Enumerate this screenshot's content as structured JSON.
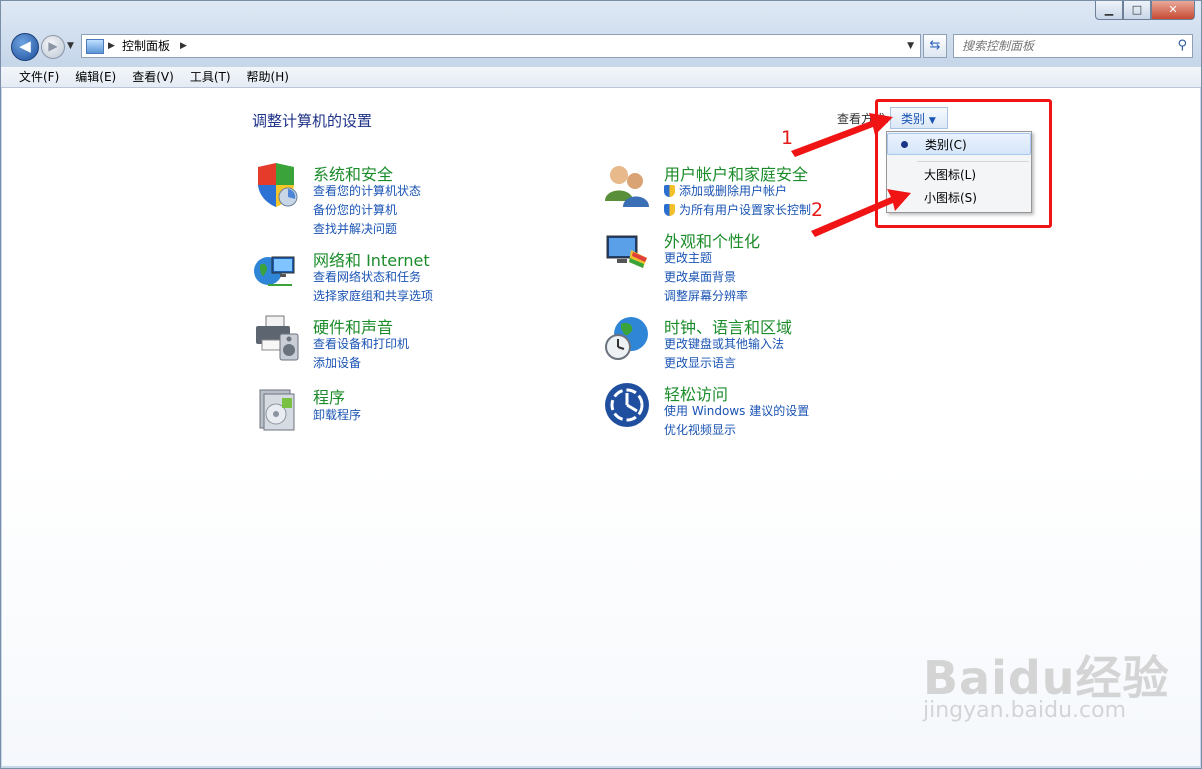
{
  "window": {
    "minimize": "▁",
    "maximize": "□",
    "close": "✕"
  },
  "nav": {
    "back_icon": "arrow-left",
    "forward_icon": "arrow-right"
  },
  "address": {
    "crumb": "控制面板"
  },
  "search": {
    "placeholder": "搜索控制面板"
  },
  "menubar": [
    "文件(F)",
    "编辑(E)",
    "查看(V)",
    "工具(T)",
    "帮助(H)"
  ],
  "page": {
    "title": "调整计算机的设置",
    "view_by_label": "查看方式:",
    "view_by_value": "类别"
  },
  "categories_left": [
    {
      "title": "系统和安全",
      "links": [
        "查看您的计算机状态",
        "备份您的计算机",
        "查找并解决问题"
      ]
    },
    {
      "title": "网络和 Internet",
      "links": [
        "查看网络状态和任务",
        "选择家庭组和共享选项"
      ]
    },
    {
      "title": "硬件和声音",
      "links": [
        "查看设备和打印机",
        "添加设备"
      ]
    },
    {
      "title": "程序",
      "links": [
        "卸载程序"
      ]
    }
  ],
  "categories_right": [
    {
      "title": "用户帐户和家庭安全",
      "links": [
        "添加或删除用户帐户",
        "为所有用户设置家长控制"
      ]
    },
    {
      "title": "外观和个性化",
      "links": [
        "更改主题",
        "更改桌面背景",
        "调整屏幕分辨率"
      ]
    },
    {
      "title": "时钟、语言和区域",
      "links": [
        "更改键盘或其他输入法",
        "更改显示语言"
      ]
    },
    {
      "title": "轻松访问",
      "links": [
        "使用 Windows 建议的设置",
        "优化视频显示"
      ]
    }
  ],
  "view_menu": {
    "items": [
      "类别(C)",
      "大图标(L)",
      "小图标(S)"
    ],
    "selected": "类别(C)"
  },
  "annotations": {
    "step1": "1",
    "step2": "2",
    "color": "#f01414"
  },
  "watermark": {
    "brand": "Baidu经验",
    "url": "jingyan.baidu.com"
  }
}
